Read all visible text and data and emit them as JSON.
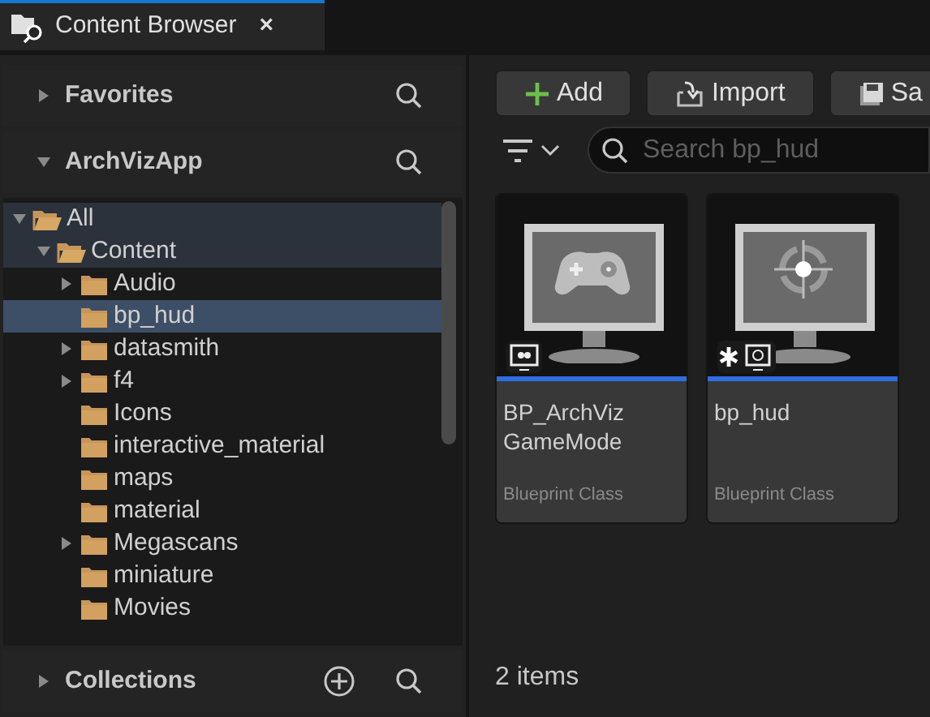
{
  "tab": {
    "title": "Content Browser",
    "close": "×"
  },
  "sidebar": {
    "favorites": {
      "label": "Favorites",
      "expanded": false
    },
    "project": {
      "label": "ArchVizApp",
      "expanded": true
    },
    "tree": [
      {
        "label": "All",
        "kind": "branch",
        "expanded": true,
        "selected": false,
        "children": [
          {
            "label": "Content",
            "kind": "branch",
            "expanded": true,
            "selected": false,
            "children": [
              {
                "label": "Audio",
                "kind": "branch",
                "expanded": false,
                "selected": false
              },
              {
                "label": "bp_hud",
                "kind": "leaf",
                "selected": true
              },
              {
                "label": "datasmith",
                "kind": "branch",
                "expanded": false,
                "selected": false
              },
              {
                "label": "f4",
                "kind": "branch",
                "expanded": false,
                "selected": false
              },
              {
                "label": "Icons",
                "kind": "leaf",
                "selected": false
              },
              {
                "label": "interactive_material",
                "kind": "leaf",
                "selected": false
              },
              {
                "label": "maps",
                "kind": "leaf",
                "selected": false
              },
              {
                "label": "material",
                "kind": "leaf",
                "selected": false
              },
              {
                "label": "Megascans",
                "kind": "branch",
                "expanded": false,
                "selected": false
              },
              {
                "label": "miniature",
                "kind": "leaf",
                "selected": false
              },
              {
                "label": "Movies",
                "kind": "leaf",
                "selected": false
              }
            ]
          }
        ]
      }
    ],
    "collections": {
      "label": "Collections",
      "expanded": false
    }
  },
  "toolbar": {
    "buttons": [
      {
        "label": "Add",
        "kind": "add"
      },
      {
        "label": "Import",
        "kind": "import"
      },
      {
        "label": "Sa",
        "kind": "save"
      }
    ]
  },
  "search": {
    "placeholder": "Search bp_hud"
  },
  "assets": [
    {
      "name": "BP_ArchViz GameMode",
      "type": "Blueprint Class",
      "kind": "gamemode"
    },
    {
      "name": "bp_hud",
      "type": "Blueprint Class",
      "kind": "hud"
    }
  ],
  "status": "2 items"
}
